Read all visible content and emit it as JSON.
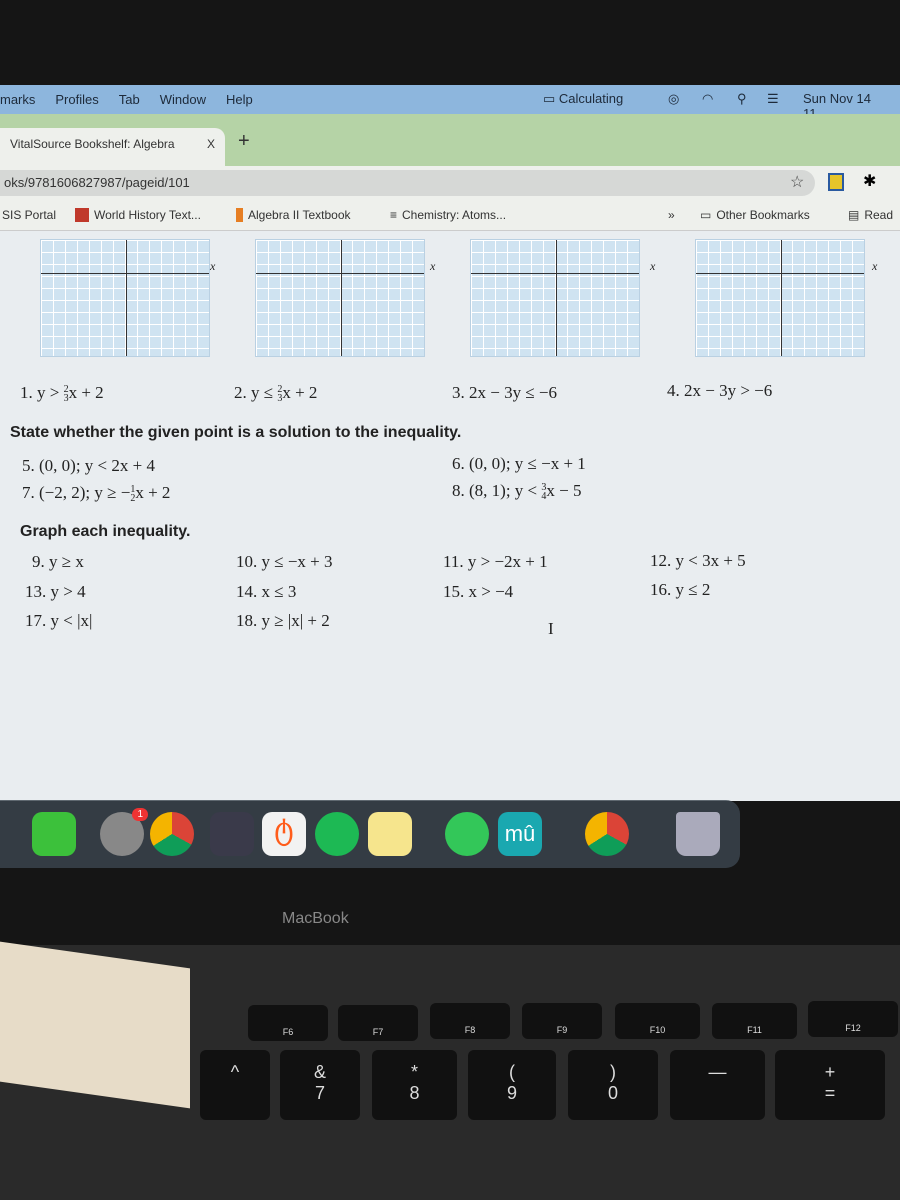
{
  "menubar": {
    "items": [
      "marks",
      "Profiles",
      "Tab",
      "Window",
      "Help"
    ],
    "status": "Calculating",
    "clock": "Sun Nov 14 11"
  },
  "tab": {
    "title": "VitalSource Bookshelf: Algebra",
    "close": "X",
    "new_tab": "+"
  },
  "address": {
    "url": "oks/9781606827987/pageid/101"
  },
  "bookmarks": {
    "items": [
      "SIS Portal",
      "World History Text...",
      "Algebra II Textbook",
      "Chemistry: Atoms..."
    ],
    "more": "»",
    "other": "Other Bookmarks",
    "reading": "Read"
  },
  "textbook": {
    "graph_axis_label": "x",
    "row1": [
      {
        "pre": "1. y > ",
        "num": "2",
        "den": "3",
        "post": "x + 2"
      },
      {
        "pre": "2. y ≤ ",
        "num": "2",
        "den": "3",
        "post": "x + 2"
      },
      {
        "text": "3. 2x − 3y ≤ −6"
      },
      {
        "text": "4. 2x − 3y > −6"
      }
    ],
    "heading1": "State whether the given point is a solution to the inequality.",
    "q5": "5. (0, 0); y < 2x + 4",
    "q6": "6. (0, 0); y ≤ −x + 1",
    "q7": {
      "pre": "7. (−2, 2); y ≥ −",
      "num": "1",
      "den": "2",
      "post": "x + 2"
    },
    "q8": {
      "pre": "8. (8, 1); y < ",
      "num": "3",
      "den": "4",
      "post": "x − 5"
    },
    "heading2": "Graph each inequality.",
    "graph_items": [
      "9. y ≥ x",
      "10. y ≤ −x + 3",
      "11. y > −2x + 1",
      "12. y < 3x + 5",
      "13. y > 4",
      "14. x ≤ 3",
      "15. x > −4",
      "16. y ≤ 2",
      "17. y < |x|",
      "18. y ≥ |x| + 2"
    ],
    "cursor": "I"
  },
  "dock": {
    "badge": "1"
  },
  "laptop": {
    "brand": "MacBook"
  },
  "keyboard": {
    "fkeys": [
      "F6",
      "F7",
      "F8",
      "F9",
      "F10",
      "F11",
      "F12"
    ],
    "keys": [
      "^",
      "&\n7",
      "*\n8",
      "(\n9",
      ")\n0",
      "—",
      "+\n="
    ]
  }
}
